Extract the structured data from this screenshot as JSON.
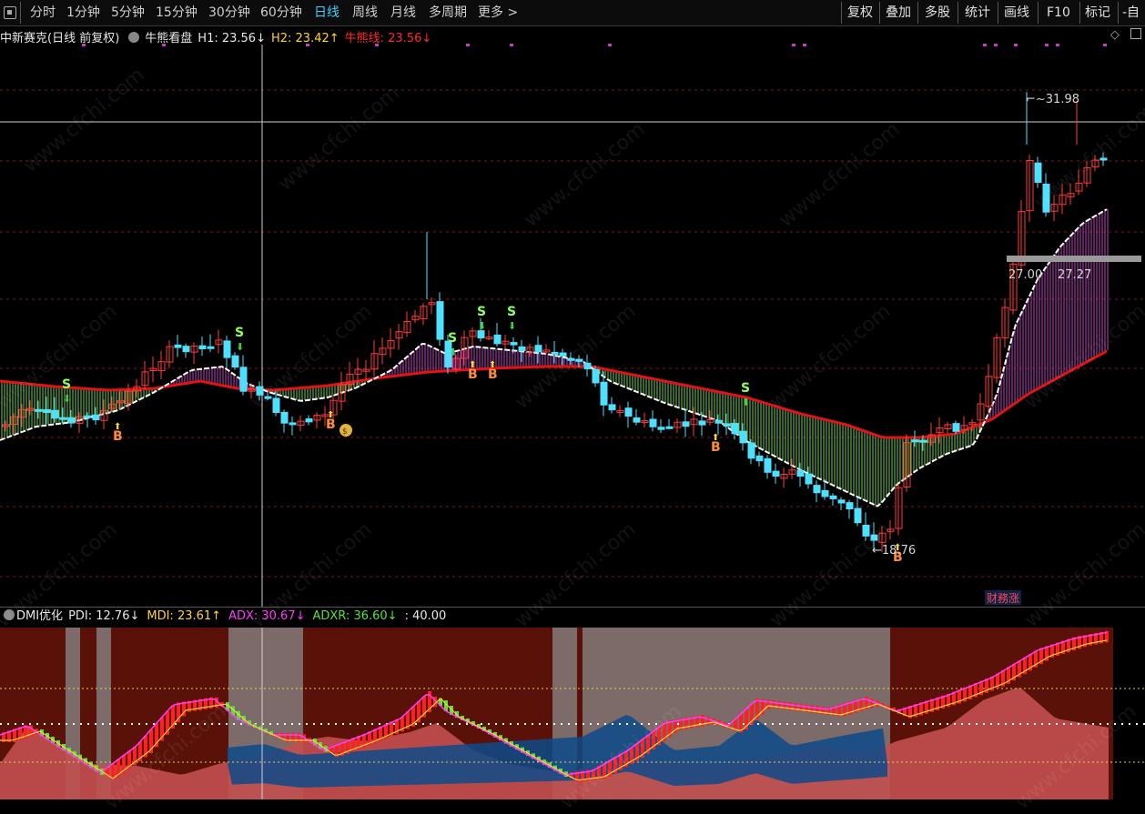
{
  "toolbar": {
    "periods": [
      "分时",
      "1分钟",
      "5分钟",
      "15分钟",
      "30分钟",
      "60分钟",
      "日线",
      "周线",
      "月线",
      "多周期",
      "更多 >"
    ],
    "active_period": "日线",
    "right_buttons": [
      "复权",
      "叠加",
      "多股",
      "统计",
      "画线",
      "F10",
      "标记",
      "-自"
    ]
  },
  "main": {
    "stock_title": "中新赛克(日线 前复权)",
    "indicator_name": "牛熊看盘",
    "h1": "H1: 23.56↓",
    "h2": "H2: 23.42↑",
    "bull_bear_line": "牛熊线: 23.56↓",
    "high_label": "31.98",
    "low_label": "18.76",
    "level_label": "27.00",
    "level_label2": "27.27",
    "badge": "财務涨",
    "buy_signal": "B",
    "sell_signal": "S",
    "colors": {
      "up": "#ff3b3b",
      "down": "#4de1ff",
      "bull_fill": "#d24bd2",
      "bear_fill": "#7fe05a",
      "ma_line": "#e01414",
      "white_line": "#ffffff"
    }
  },
  "dmi": {
    "name": "DMI优化",
    "pdi": "PDI: 12.76↓",
    "mdi": "MDI: 23.61↑",
    "adx": "ADX: 30.67↓",
    "adxr": "ADXR: 36.60↓",
    "level": ": 40.00"
  },
  "watermark": "www.cfchi.com"
}
